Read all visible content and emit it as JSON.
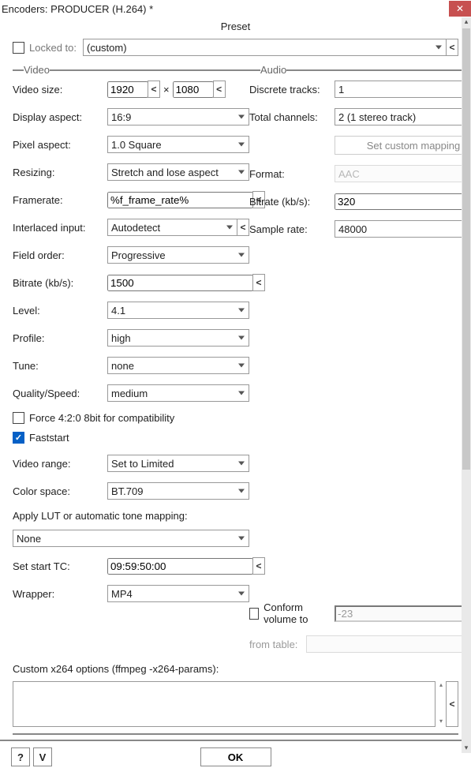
{
  "window_title": "Encoders: PRODUCER (H.264) *",
  "preset_label": "Preset",
  "lock": {
    "label": "Locked to:",
    "value": "(custom)"
  },
  "group": {
    "video": "Video",
    "audio": "Audio"
  },
  "video": {
    "size_label": "Video size:",
    "width": "1920",
    "height": "1080",
    "display_aspect_label": "Display aspect:",
    "display_aspect": "16:9",
    "pixel_aspect_label": "Pixel aspect:",
    "pixel_aspect": "1.0 Square",
    "resizing_label": "Resizing:",
    "resizing": "Stretch and lose aspect",
    "framerate_label": "Framerate:",
    "framerate": "%f_frame_rate%",
    "interlaced_label": "Interlaced input:",
    "interlaced": "Autodetect",
    "field_order_label": "Field order:",
    "field_order": "Progressive",
    "bitrate_label": "Bitrate (kb/s):",
    "bitrate": "1500",
    "level_label": "Level:",
    "level": "4.1",
    "profile_label": "Profile:",
    "profile": "high",
    "tune_label": "Tune:",
    "tune": "none",
    "quality_label": "Quality/Speed:",
    "quality": "medium",
    "force_420_label": "Force 4:2:0 8bit for compatibility",
    "faststart_label": "Faststart",
    "range_label": "Video range:",
    "range": "Set to Limited",
    "colorspace_label": "Color space:",
    "colorspace": "BT.709",
    "lut_label": "Apply LUT or automatic tone mapping:",
    "lut": "None",
    "tc_label": "Set start TC:",
    "tc": "09:59:50:00",
    "wrapper_label": "Wrapper:",
    "wrapper": "MP4",
    "x264_label": "Custom x264 options (ffmpeg -x264-params):",
    "x264": ""
  },
  "audio": {
    "discrete_label": "Discrete tracks:",
    "discrete": "1",
    "channels_label": "Total channels:",
    "channels": "2 (1 stereo track)",
    "mapping_btn": "Set custom mapping",
    "format_label": "Format:",
    "format": "AAC",
    "bitrate_label": "Bitrate (kb/s):",
    "bitrate": "320",
    "sample_label": "Sample rate:",
    "sample": "48000",
    "conform_label": "Conform volume to",
    "conform_value": "-23",
    "from_table_label": "from table:",
    "from_table_value": ""
  },
  "footer": {
    "help": "?",
    "v": "V",
    "ok": "OK"
  }
}
